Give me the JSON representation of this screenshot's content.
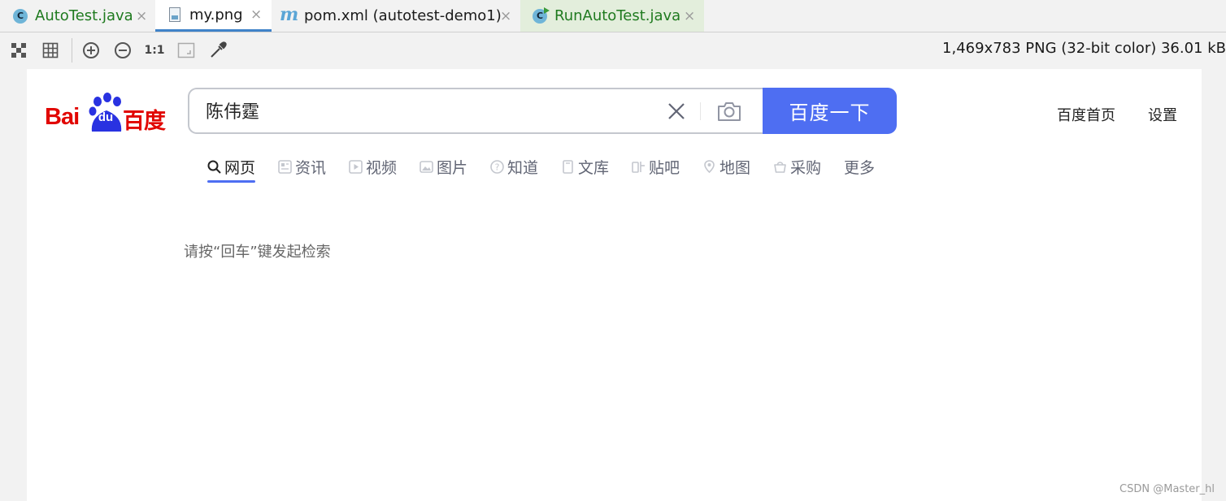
{
  "tabs": [
    {
      "label": "AutoTest.java",
      "icon": "java-class-icon",
      "close": "×"
    },
    {
      "label": "my.png",
      "icon": "image-file-icon",
      "close": "×"
    },
    {
      "label": "pom.xml (autotest-demo1)",
      "icon": "maven-icon",
      "close": "×"
    },
    {
      "label": "RunAutoTest.java",
      "icon": "java-runnable-class-icon",
      "close": "×"
    }
  ],
  "toolbar": {
    "actual_size_label": "1:1",
    "image_info": "1,469x783 PNG (32-bit color) 36.01 kB"
  },
  "baidu": {
    "logo": {
      "bai": "Bai",
      "du": "du",
      "cn": "百度"
    },
    "search_value": "陈伟霆",
    "search_button": "百度一下",
    "top_links": [
      "百度首页",
      "设置"
    ],
    "nav": [
      "网页",
      "资讯",
      "视频",
      "图片",
      "知道",
      "文库",
      "贴吧",
      "地图",
      "采购",
      "更多"
    ],
    "hint": "请按“回车”键发起检索"
  },
  "colors": {
    "baidu_blue": "#4e6ef2",
    "baidu_red": "#e10602",
    "tab_active_underline": "#4083c9"
  },
  "watermark": "CSDN @Master_hl"
}
